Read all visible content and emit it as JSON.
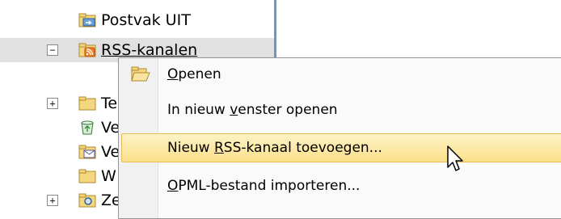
{
  "tree": {
    "items": [
      {
        "label": "Postvak UIT"
      },
      {
        "label": "RSS-kanalen",
        "expander": "⊟"
      },
      {
        "label": "Te",
        "expander": "⊞"
      },
      {
        "label": "Ve"
      },
      {
        "label": "Ve"
      },
      {
        "label": "W"
      },
      {
        "label": "Ze",
        "expander": "⊞"
      }
    ]
  },
  "context_menu": {
    "items": [
      {
        "pre": "",
        "key": "O",
        "post": "penen"
      },
      {
        "pre": "In nieuw ",
        "key": "v",
        "post": "enster openen"
      },
      {
        "pre": "Nieuw ",
        "key": "R",
        "post": "SS-kanaal toevoegen..."
      },
      {
        "pre": "",
        "key": "O",
        "post": "PML-bestand importeren..."
      }
    ]
  },
  "colors": {
    "selection": "#e1e1e1",
    "hover_top": "#fdf3c7",
    "hover_bottom": "#fbe08a",
    "divider": "#6f94c9"
  }
}
